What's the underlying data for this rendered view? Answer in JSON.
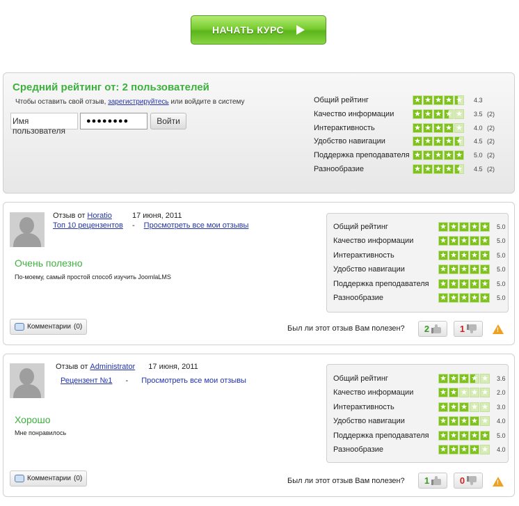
{
  "start_button": {
    "label": "НАЧАТЬ КУРС"
  },
  "colors": {
    "accent_green": "#3db03d",
    "star_fill": "#7fc11d",
    "link_blue": "#2233aa",
    "warning": "#f0a020"
  },
  "summary": {
    "title": "Средний рейтинг от: 2 пользователей",
    "hint_before": "Чтобы оставить свой отзыв,",
    "hint_link": "зарегистрируйтесь",
    "hint_after": "или войдите в систему",
    "username_placeholder": "Имя пользователя",
    "password_mask": "●●●●●●●●",
    "login_label": "Войти",
    "ratings": [
      {
        "label": "Общий рейтинг",
        "value": 4.3,
        "value_text": "4.3",
        "count": ""
      },
      {
        "label": "Качество информации",
        "value": 3.5,
        "value_text": "3.5",
        "count": "(2)"
      },
      {
        "label": "Интерактивность",
        "value": 4.0,
        "value_text": "4.0",
        "count": "(2)"
      },
      {
        "label": "Удобство навигации",
        "value": 4.5,
        "value_text": "4.5",
        "count": "(2)"
      },
      {
        "label": "Поддержка преподавателя",
        "value": 5.0,
        "value_text": "5.0",
        "count": "(2)"
      },
      {
        "label": "Разнообразие",
        "value": 4.5,
        "value_text": "4.5",
        "count": "(2)"
      }
    ]
  },
  "reviews": [
    {
      "review_by": "Отзыв от",
      "author": "Horatio",
      "date": "17 июня, 2011",
      "rank_link": "Топ 10 рецензентов",
      "separator": "-",
      "all_reviews_link": "Просмотреть все мои отзывы",
      "title": "Очень полезно",
      "text": "По-моему, самый простой способ изучить JoomlaLMS",
      "comments_label": "Комментарии",
      "comments_count": "(0)",
      "helpful_question": "Был ли этот отзыв Вам полезен?",
      "yes_count": "2",
      "no_count": "1",
      "warning_glyph": "!",
      "ratings": [
        {
          "label": "Общий рейтинг",
          "value": 5.0,
          "value_text": "5.0"
        },
        {
          "label": "Качество информации",
          "value": 5.0,
          "value_text": "5.0"
        },
        {
          "label": "Интерактивность",
          "value": 5.0,
          "value_text": "5.0"
        },
        {
          "label": "Удобство навигации",
          "value": 5.0,
          "value_text": "5.0"
        },
        {
          "label": "Поддержка преподавателя",
          "value": 5.0,
          "value_text": "5.0"
        },
        {
          "label": "Разнообразие",
          "value": 5.0,
          "value_text": "5.0"
        }
      ]
    },
    {
      "review_by": "Отзыв от",
      "author": "Administrator",
      "date": "17 июня, 2011",
      "rank_link": "Рецензент №1",
      "separator": "-",
      "all_reviews_link": "Просмотреть все мои отзывы",
      "title": "Хорошо",
      "text": "Мне понравилось",
      "comments_label": "Комментарии",
      "comments_count": "(0)",
      "helpful_question": "Был ли этот отзыв Вам полезен?",
      "yes_count": "1",
      "no_count": "0",
      "warning_glyph": "!",
      "ratings": [
        {
          "label": "Общий рейтинг",
          "value": 3.6,
          "value_text": "3.6"
        },
        {
          "label": "Качество информации",
          "value": 2.0,
          "value_text": "2.0"
        },
        {
          "label": "Интерактивность",
          "value": 3.0,
          "value_text": "3.0"
        },
        {
          "label": "Удобство навигации",
          "value": 4.0,
          "value_text": "4.0"
        },
        {
          "label": "Поддержка преподавателя",
          "value": 5.0,
          "value_text": "5.0"
        },
        {
          "label": "Разнообразие",
          "value": 4.0,
          "value_text": "4.0"
        }
      ]
    }
  ]
}
